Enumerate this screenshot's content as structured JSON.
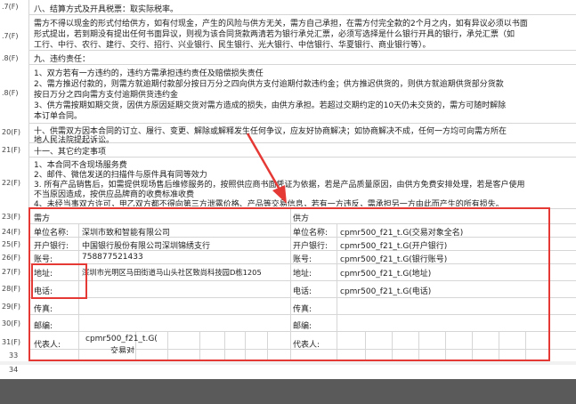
{
  "rows": {
    "r14": {
      "label": ".7(F)",
      "text": "八、结算方式及开具税票：取实际税率。"
    },
    "r15": {
      "label": ".7(F)",
      "lines": [
        "需方不得以现金的形式付给供方，如有付现金，产生的风险与供方无关，需方自己承担，在需方付完全款的2个月之内，如有异议必须以书面",
        "形式提出，若到期没有提出任何书面异议，则视为该合同货款两清若为银行承兑汇票，必须写选择是什么银行开具的银行，承兑汇票（如",
        "工行、中行、农行、建行、交行、招行、兴业银行、民生银行、光大银行、中信银行、华夏银行、商业银行等）。"
      ]
    },
    "r16": {
      "label": ".8(F)",
      "text": "九、违约责任："
    },
    "r17": {
      "label": ".8(F)",
      "lines": [
        "1、双方若有一方违约的，违约方需承担违约责任及赔偿损失责任",
        "2、需方推迟付款的，则需方就逾期付款部分按日万分之四向供方支付逾期付款违约金；供方推迟供货的，则供方就逾期供货部分货款",
        "按日万分之四向需方支付逾期供货违约金",
        "3、供方需按期如期交货，因供方原因延期交货对需方造成的损失，由供方承担。若超过交期约定的10天仍未交货的，需方可随时解除",
        "本订单合同。"
      ]
    },
    "r20": {
      "label": "20(F)",
      "lines": [
        "十、供需双方因本合同的订立、履行、变更、解除或解释发生任何争议，应友好协商解决；如协商解决不成，任何一方均可向需方所在",
        "地人民法院提起诉讼。"
      ]
    },
    "r21": {
      "label": "21(F)",
      "text": "十一、其它约定事项"
    },
    "r22": {
      "label": "22(F)",
      "lines": [
        "1、本合同不含现场服务费",
        "2、邮件、微信发送的扫描件与原件具有同等效力",
        "3. 所有产品销售后，如需提供现场售后维修服务的，按照供应商书面凭证为依据，若是产品质量原因，由供方免费安排处理，若是客户使用",
        "不当原因造成，按供应品牌商的收费标准收费",
        "4、未经当事双方许可，甲乙双方都不得向第三方泄露价格、产品等交易信息，若有一方违反，需承担另一方由此而产生的所有损失。"
      ]
    },
    "r23": {
      "label": "23(F)",
      "left": "需方",
      "right": "供方"
    },
    "r24": {
      "label": "24(F)",
      "left_label": "单位名称:",
      "left_value": "深圳市致和智能有限公司",
      "right_label": "单位名称:",
      "right_value": "cpmr500_f21_t.G(交易对象全名)"
    },
    "r25": {
      "label": "25(F)",
      "left_label": "开户银行:",
      "left_value": "中国银行股份有限公司深圳锦绣支行",
      "right_label": "开户银行:",
      "right_value": "cpmr500_f21_t.G(开户银行)"
    },
    "r26": {
      "label": "26(F)",
      "left_label": "账号:",
      "left_value": "758877521433",
      "right_label": "账号:",
      "right_value": "cpmr500_f21_t.G(银行账号)"
    },
    "r27": {
      "label": "27(F)",
      "left_label": "地址:",
      "left_value": "深圳市光明区马田街道马山头社区致尚科技园D栋1205",
      "right_label": "地址:",
      "right_value": "cpmr500_f21_t.G(地址)"
    },
    "r28": {
      "label": "28(F)",
      "left_label": "电话:",
      "left_value": "",
      "right_label": "电话:",
      "right_value": "cpmr500_f21_t.G(电话)"
    },
    "r29": {
      "label": "29(F)",
      "left_label": "传真:",
      "right_label": "传真:"
    },
    "r30": {
      "label": "30(F)",
      "left_label": "邮编:",
      "right_label": "邮编:"
    },
    "r31": {
      "label": "31(F)",
      "left_label": "代表人:",
      "left_value_1": "cpmr500_f21_t.G(",
      "left_value_2": "交易对",
      "right_label": "代表人:"
    },
    "r33": {
      "label": "33"
    },
    "r34": {
      "label": "34"
    }
  },
  "colors": {
    "highlight": "#e53935",
    "grid": "#d6d6d6"
  }
}
